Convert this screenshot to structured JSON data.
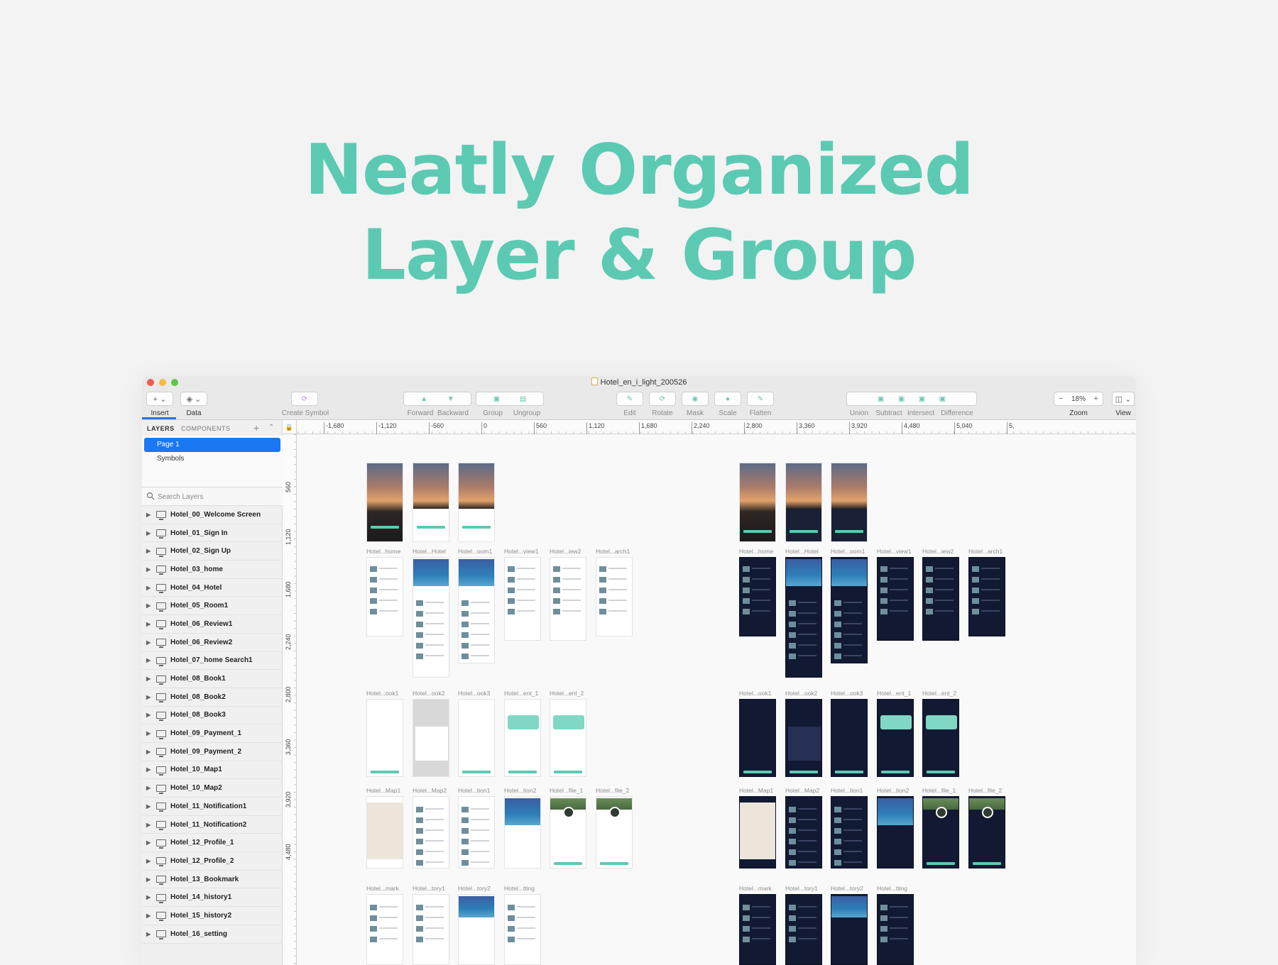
{
  "hero": {
    "line1": "Neatly Organized",
    "line2": "Layer & Group"
  },
  "window": {
    "title": "Hotel_en_i_light_200526"
  },
  "toolbar": {
    "insert_label": "Insert",
    "data_label": "Data",
    "create_symbol_label": "Create Symbol",
    "forward_label": "Forward",
    "backward_label": "Backward",
    "group_label": "Group",
    "ungroup_label": "Ungroup",
    "edit_label": "Edit",
    "rotate_label": "Rotate",
    "mask_label": "Mask",
    "scale_label": "Scale",
    "flatten_label": "Flatten",
    "union_label": "Union",
    "subtract_label": "Subtract",
    "intersect_label": "Intersect",
    "difference_label": "Difference",
    "zoom_label": "Zoom",
    "zoom_value": "18%",
    "view_label": "View"
  },
  "sidebar": {
    "tab_layers": "LAYERS",
    "tab_components": "COMPONENTS",
    "pages": [
      "Page 1",
      "Symbols"
    ],
    "search_placeholder": "Search Layers",
    "layers": [
      "Hotel_00_Welcome Screen",
      "Hotel_01_Sign In",
      "Hotel_02_Sign Up",
      "Hotel_03_home",
      "Hotel_04_Hotel",
      "Hotel_05_Room1",
      "Hotel_06_Review1",
      "Hotel_06_Review2",
      "Hotel_07_home Search1",
      "Hotel_08_Book1",
      "Hotel_08_Book2",
      "Hotel_08_Book3",
      "Hotel_09_Payment_1",
      "Hotel_09_Payment_2",
      "Hotel_10_Map1",
      "Hotel_10_Map2",
      "Hotel_11_Notification1",
      "Hotel_11_Notification2",
      "Hotel_12_Profile_1",
      "Hotel_12_Profile_2",
      "Hotel_13_Bookmark",
      "Hotel_14_history1",
      "Hotel_15_history2",
      "Hotel_16_setting"
    ]
  },
  "rulers": {
    "horizontal": [
      "-1,680",
      "-1,120",
      "-560",
      "0",
      "560",
      "1,120",
      "1,680",
      "2,240",
      "2,800",
      "3,360",
      "3,920",
      "4,480",
      "5,040",
      "5,"
    ],
    "vertical": [
      "560",
      "1,120",
      "1,680",
      "2,240",
      "2,800",
      "3,360",
      "3,920",
      "4,480"
    ]
  },
  "canvas": {
    "row1_labels": [
      "Hotel...home",
      "Hotel...Hotel",
      "Hotel...oom1",
      "Hotel...view1",
      "Hotel...iew2",
      "Hotel...arch1"
    ],
    "row2_labels": [
      "Hotel...ook1",
      "Hotel...ook2",
      "Hotel...ook3",
      "Hotel...ent_1",
      "Hotel...ent_2"
    ],
    "row3_labels": [
      "Hotel...Map1",
      "Hotel...Map2",
      "Hotel...tion1",
      "Hotel...tion2",
      "Hotel...file_1",
      "Hotel...file_2"
    ],
    "row4_light_labels": [
      "Hotel...mark",
      "Hotel...tory1",
      "Hotel...tory2",
      "Hotel...tting"
    ],
    "row4_dark_labels": [
      "Hotel...mark",
      "Hotel...tory1",
      "Hotel...tory2",
      "Hotel...tting"
    ]
  },
  "colors": {
    "accent": "#5ccab3",
    "selection": "#1a78f2",
    "dark_artboard": "#121a33"
  }
}
